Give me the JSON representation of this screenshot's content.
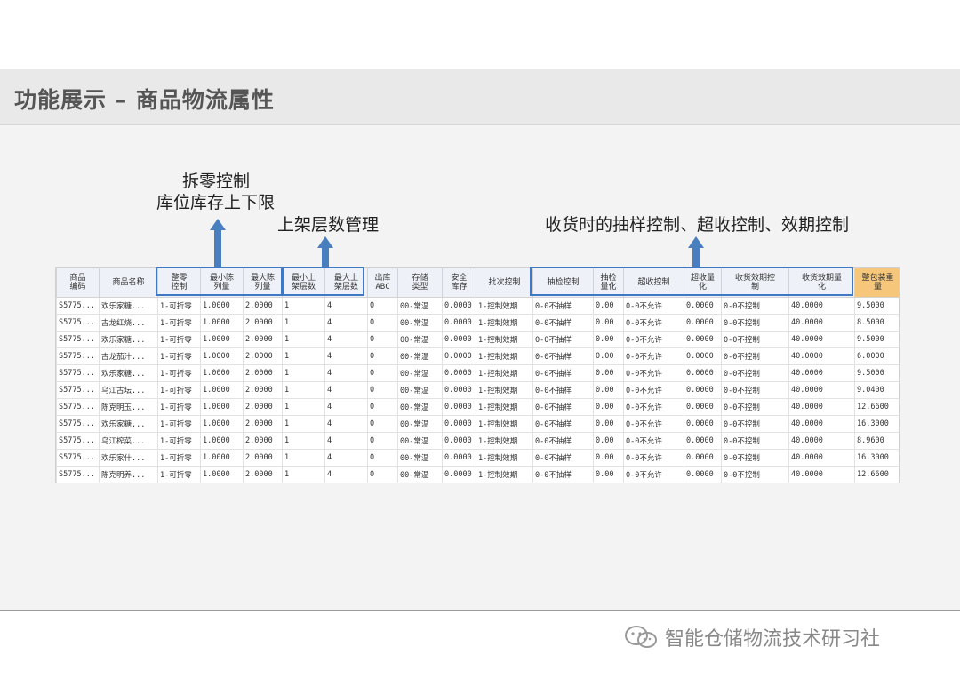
{
  "title": "功能展示 – 商品物流属性",
  "annotations": {
    "split_line1": "拆零控制",
    "split_line2": "库位库存上下限",
    "layer": "上架层数管理",
    "receiving": "收货时的抽样控制、超收控制、效期控制"
  },
  "table": {
    "headers": [
      "商品\n编码",
      "商品名称",
      "整零\n控制",
      "最小陈\n列量",
      "最大陈\n列量",
      "最小上\n架层数",
      "最大上\n架层数",
      "出库\nABC",
      "存储\n类型",
      "安全\n库存",
      "批次控制",
      "抽检控制",
      "抽检\n量化",
      "超收控制",
      "超收量\n化",
      "收货效期控\n制",
      "收货效期量\n化",
      "整包装重\n量"
    ],
    "rows": [
      [
        "S5775...",
        "欢乐家糖...",
        "1-可折零",
        "1.0000",
        "2.0000",
        "1",
        "4",
        "0",
        "00-常温",
        "0.0000",
        "1-控制效期",
        "0-0不抽样",
        "0.00",
        "0-0不允许",
        "0.0000",
        "0-0不控制",
        "40.0000",
        "9.5000"
      ],
      [
        "S5775...",
        "古龙红烧...",
        "1-可折零",
        "1.0000",
        "2.0000",
        "1",
        "4",
        "0",
        "00-常温",
        "0.0000",
        "1-控制效期",
        "0-0不抽样",
        "0.00",
        "0-0不允许",
        "0.0000",
        "0-0不控制",
        "40.0000",
        "8.5000"
      ],
      [
        "S5775...",
        "欢乐家糖...",
        "1-可折零",
        "1.0000",
        "2.0000",
        "1",
        "4",
        "0",
        "00-常温",
        "0.0000",
        "1-控制效期",
        "0-0不抽样",
        "0.00",
        "0-0不允许",
        "0.0000",
        "0-0不控制",
        "40.0000",
        "9.5000"
      ],
      [
        "S5775...",
        "古龙茄汁...",
        "1-可折零",
        "1.0000",
        "2.0000",
        "1",
        "4",
        "0",
        "00-常温",
        "0.0000",
        "1-控制效期",
        "0-0不抽样",
        "0.00",
        "0-0不允许",
        "0.0000",
        "0-0不控制",
        "40.0000",
        "6.0000"
      ],
      [
        "S5775...",
        "欢乐家糖...",
        "1-可折零",
        "1.0000",
        "2.0000",
        "1",
        "4",
        "0",
        "00-常温",
        "0.0000",
        "1-控制效期",
        "0-0不抽样",
        "0.00",
        "0-0不允许",
        "0.0000",
        "0-0不控制",
        "40.0000",
        "9.5000"
      ],
      [
        "S5775...",
        "乌江古坛...",
        "1-可折零",
        "1.0000",
        "2.0000",
        "1",
        "4",
        "0",
        "00-常温",
        "0.0000",
        "1-控制效期",
        "0-0不抽样",
        "0.00",
        "0-0不允许",
        "0.0000",
        "0-0不控制",
        "40.0000",
        "9.0400"
      ],
      [
        "S5775...",
        "陈克明玉...",
        "1-可折零",
        "1.0000",
        "2.0000",
        "1",
        "4",
        "0",
        "00-常温",
        "0.0000",
        "1-控制效期",
        "0-0不抽样",
        "0.00",
        "0-0不允许",
        "0.0000",
        "0-0不控制",
        "40.0000",
        "12.6600"
      ],
      [
        "S5775...",
        "欢乐家糖...",
        "1-可折零",
        "1.0000",
        "2.0000",
        "1",
        "4",
        "0",
        "00-常温",
        "0.0000",
        "1-控制效期",
        "0-0不抽样",
        "0.00",
        "0-0不允许",
        "0.0000",
        "0-0不控制",
        "40.0000",
        "16.3000"
      ],
      [
        "S5775...",
        "乌江榨菜...",
        "1-可折零",
        "1.0000",
        "2.0000",
        "1",
        "4",
        "0",
        "00-常温",
        "0.0000",
        "1-控制效期",
        "0-0不抽样",
        "0.00",
        "0-0不允许",
        "0.0000",
        "0-0不控制",
        "40.0000",
        "8.9600"
      ],
      [
        "S5775...",
        "欢乐家什...",
        "1-可折零",
        "1.0000",
        "2.0000",
        "1",
        "4",
        "0",
        "00-常温",
        "0.0000",
        "1-控制效期",
        "0-0不抽样",
        "0.00",
        "0-0不允许",
        "0.0000",
        "0-0不控制",
        "40.0000",
        "16.3000"
      ],
      [
        "S5775...",
        "陈克明养...",
        "1-可折零",
        "1.0000",
        "2.0000",
        "1",
        "4",
        "0",
        "00-常温",
        "0.0000",
        "1-控制效期",
        "0-0不抽样",
        "0.00",
        "0-0不允许",
        "0.0000",
        "0-0不控制",
        "40.0000",
        "12.6600"
      ]
    ]
  },
  "watermark": "智能仓储物流技术研习社",
  "colors": {
    "arrow": "#4a7fbf",
    "highlight_border": "#3f79c3",
    "weight_header": "#f6c77a",
    "header_bg": "#eef2f8"
  }
}
